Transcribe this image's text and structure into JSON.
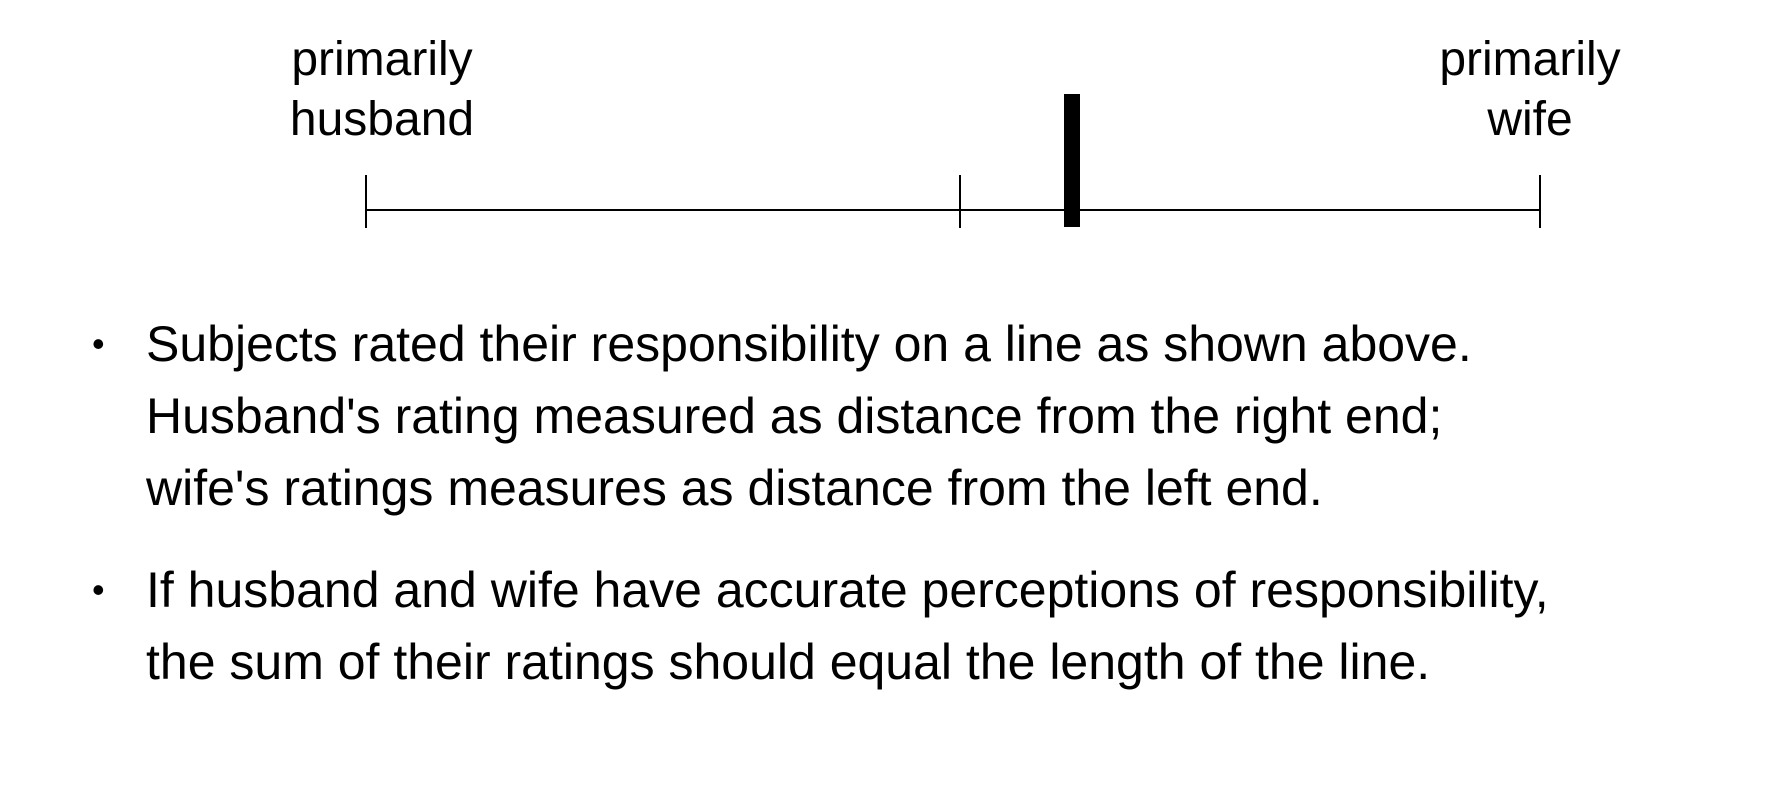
{
  "scale": {
    "left_label": [
      "primarily",
      "husband"
    ],
    "right_label": [
      "primarily",
      "wife"
    ]
  },
  "bullet_symbol": "•",
  "bullets": [
    {
      "lines": [
        "Subjects rated their responsibility on a line as shown above.",
        "Husband's rating measured as distance from the right end;",
        "wife's ratings measures as distance from the left end."
      ]
    },
    {
      "lines": [
        "If husband and wife have accurate perceptions of responsibility,",
        "the sum of their ratings should equal the length of the line."
      ]
    }
  ]
}
